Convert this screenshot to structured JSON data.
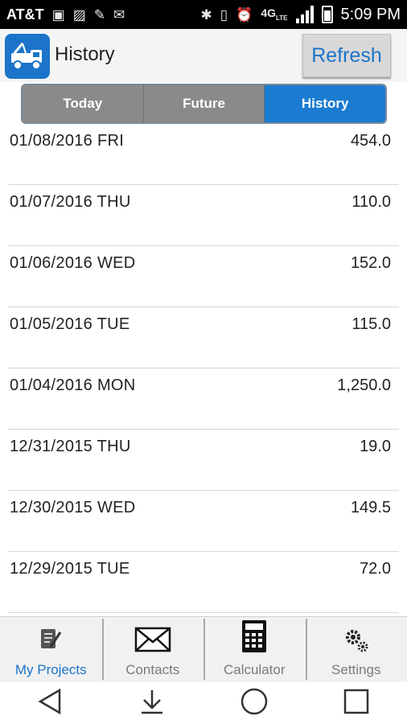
{
  "status_bar": {
    "carrier": "AT&T",
    "time": "5:09 PM",
    "network": "4G",
    "network_sub": "LTE"
  },
  "app_bar": {
    "title": "History",
    "refresh_label": "Refresh"
  },
  "tabs": [
    {
      "label": "Today",
      "active": false
    },
    {
      "label": "Future",
      "active": false
    },
    {
      "label": "History",
      "active": true
    }
  ],
  "history": [
    {
      "date": "01/08/2016 FRI",
      "amount": "454.0"
    },
    {
      "date": "01/07/2016 THU",
      "amount": "110.0"
    },
    {
      "date": "01/06/2016 WED",
      "amount": "152.0"
    },
    {
      "date": "01/05/2016 TUE",
      "amount": "115.0"
    },
    {
      "date": "01/04/2016 MON",
      "amount": "1,250.0"
    },
    {
      "date": "12/31/2015 THU",
      "amount": "19.0"
    },
    {
      "date": "12/30/2015 WED",
      "amount": "149.5"
    },
    {
      "date": "12/29/2015 TUE",
      "amount": "72.0"
    }
  ],
  "bottom_nav": [
    {
      "label": "My Projects",
      "icon": "notepad-pen-icon",
      "active": true
    },
    {
      "label": "Contacts",
      "icon": "envelope-icon",
      "active": false
    },
    {
      "label": "Calculator",
      "icon": "calculator-icon",
      "active": false
    },
    {
      "label": "Settings",
      "icon": "gears-icon",
      "active": false
    }
  ],
  "colors": {
    "accent": "#1b74c9",
    "tab_active": "#1b7bd1",
    "tab_inactive": "#8a8a8a"
  }
}
